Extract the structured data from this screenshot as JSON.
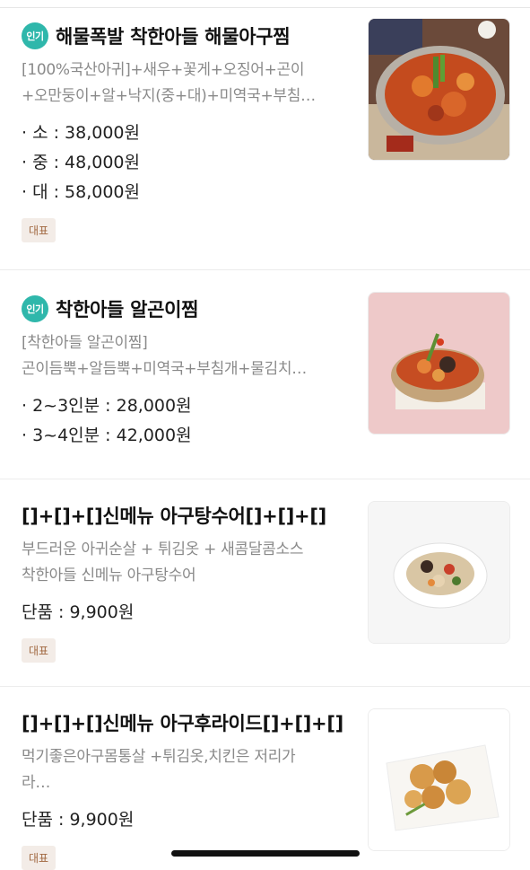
{
  "menu_items": [
    {
      "badge": "인기",
      "title": "해물폭발 착한아들   해물아구찜",
      "desc_lines": [
        "[100%국산아귀]+새우+꽃게+오징어+곤이",
        "+오만둥이+알+낙지(중+대)+미역국+부침…"
      ],
      "prices": [
        "· 소 : 38,000원",
        "· 중 : 48,000원",
        "· 대 : 58,000원"
      ],
      "tag": "대표",
      "image": "seafood-agujjim-photo"
    },
    {
      "badge": "인기",
      "title": "착한아들 알곤이찜",
      "desc_lines": [
        "[착한아들 알곤이찜]",
        "곤이듬뿍+알듬뿍+미역국+부침개+물김치…"
      ],
      "prices": [
        "· 2~3인분 : 28,000원",
        "· 3~4인분 : 42,000원"
      ],
      "tag": "",
      "image": "algonijjim-photo"
    },
    {
      "badge": "",
      "title": "[]+[]+[]신메뉴 아구탕수어[]+[]+[]",
      "desc_lines": [
        "부드러운 아귀순살 + 튀김옷 + 새콤달콤소스",
        "착한아들 신메뉴 아구탕수어"
      ],
      "prices": [
        "단품 : 9,900원"
      ],
      "tag": "대표",
      "image": "agu-tangsueo-photo"
    },
    {
      "badge": "",
      "title": "[]+[]+[]신메뉴 아구후라이드[]+[]+[]",
      "desc_lines": [
        "먹기좋은아구몸통살 +튀김옷,치킨은 저리가",
        "라…"
      ],
      "prices": [
        "단품 : 9,900원"
      ],
      "tag": "대표",
      "image": "agu-fried-photo"
    }
  ],
  "colors": {
    "badge": "#2fb7ab",
    "tag_bg": "#f3ece7",
    "tag_text": "#a0673f",
    "desc": "#8a8a8a"
  }
}
